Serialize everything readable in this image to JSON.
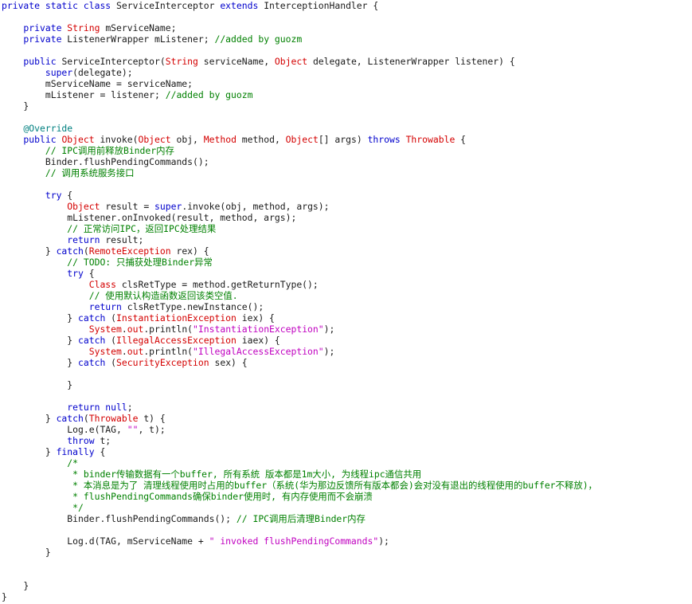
{
  "colors": {
    "background": "#ffffff",
    "text": "#1a1a1a",
    "keyword": "#0000cc",
    "type": "#d40000",
    "string": "#c000c0",
    "comment": "#008000",
    "annotation": "#008080"
  },
  "code": {
    "language": "java",
    "lines": [
      [
        [
          "kw",
          "private static class "
        ],
        [
          "plain",
          "ServiceInterceptor "
        ],
        [
          "kw",
          "extends "
        ],
        [
          "plain",
          "InterceptionHandler {"
        ]
      ],
      [],
      [
        [
          "kw",
          "    private "
        ],
        [
          "typ",
          "String "
        ],
        [
          "plain",
          "mServiceName;"
        ]
      ],
      [
        [
          "kw",
          "    private "
        ],
        [
          "plain",
          "ListenerWrapper mListener; "
        ],
        [
          "cmt",
          "//added by guozm"
        ]
      ],
      [],
      [
        [
          "kw",
          "    public "
        ],
        [
          "plain",
          "ServiceInterceptor("
        ],
        [
          "typ",
          "String "
        ],
        [
          "plain",
          "serviceName, "
        ],
        [
          "typ",
          "Object "
        ],
        [
          "plain",
          "delegate, ListenerWrapper listener) {"
        ]
      ],
      [
        [
          "kw",
          "        super"
        ],
        [
          "plain",
          "(delegate);"
        ]
      ],
      [
        [
          "plain",
          "        mServiceName = serviceName;"
        ]
      ],
      [
        [
          "plain",
          "        mListener = listener; "
        ],
        [
          "cmt",
          "//added by guozm"
        ]
      ],
      [
        [
          "plain",
          "    }"
        ]
      ],
      [],
      [
        [
          "ann",
          "    @Override"
        ]
      ],
      [
        [
          "kw",
          "    public "
        ],
        [
          "typ",
          "Object "
        ],
        [
          "plain",
          "invoke("
        ],
        [
          "typ",
          "Object "
        ],
        [
          "plain",
          "obj, "
        ],
        [
          "typ",
          "Method "
        ],
        [
          "plain",
          "method, "
        ],
        [
          "typ",
          "Object"
        ],
        [
          "plain",
          "[] args) "
        ],
        [
          "kw",
          "throws "
        ],
        [
          "typ",
          "Throwable "
        ],
        [
          "plain",
          "{"
        ]
      ],
      [
        [
          "cmt",
          "        // IPC调用前释放Binder内存"
        ]
      ],
      [
        [
          "plain",
          "        Binder.flushPendingCommands();"
        ]
      ],
      [
        [
          "cmt",
          "        // 调用系统服务接口"
        ]
      ],
      [],
      [
        [
          "kw",
          "        try "
        ],
        [
          "plain",
          "{"
        ]
      ],
      [
        [
          "typ",
          "            Object "
        ],
        [
          "plain",
          "result = "
        ],
        [
          "kw",
          "super"
        ],
        [
          "plain",
          ".invoke(obj, method, args);"
        ]
      ],
      [
        [
          "plain",
          "            mListener.onInvoked(result, method, args);"
        ]
      ],
      [
        [
          "cmt",
          "            // 正常访问IPC，返回IPC处理结果"
        ]
      ],
      [
        [
          "kw",
          "            return "
        ],
        [
          "plain",
          "result;"
        ]
      ],
      [
        [
          "plain",
          "        } "
        ],
        [
          "kw",
          "catch"
        ],
        [
          "plain",
          "("
        ],
        [
          "typ",
          "RemoteException "
        ],
        [
          "plain",
          "rex) {"
        ]
      ],
      [
        [
          "cmt",
          "            // TODO: 只捕获处理Binder异常"
        ]
      ],
      [
        [
          "kw",
          "            try "
        ],
        [
          "plain",
          "{"
        ]
      ],
      [
        [
          "typ",
          "                Class "
        ],
        [
          "plain",
          "clsRetType = method.getReturnType();"
        ]
      ],
      [
        [
          "cmt",
          "                // 使用默认构造函数返回该类空值."
        ]
      ],
      [
        [
          "kw",
          "                return "
        ],
        [
          "plain",
          "clsRetType.newInstance();"
        ]
      ],
      [
        [
          "plain",
          "            } "
        ],
        [
          "kw",
          "catch "
        ],
        [
          "plain",
          "("
        ],
        [
          "typ",
          "InstantiationException "
        ],
        [
          "plain",
          "iex) {"
        ]
      ],
      [
        [
          "typ",
          "                System"
        ],
        [
          "plain",
          "."
        ],
        [
          "typ",
          "out"
        ],
        [
          "plain",
          ".println("
        ],
        [
          "str",
          "\"InstantiationException\""
        ],
        [
          "plain",
          ");"
        ]
      ],
      [
        [
          "plain",
          "            } "
        ],
        [
          "kw",
          "catch "
        ],
        [
          "plain",
          "("
        ],
        [
          "typ",
          "IllegalAccessException "
        ],
        [
          "plain",
          "iaex) {"
        ]
      ],
      [
        [
          "typ",
          "                System"
        ],
        [
          "plain",
          "."
        ],
        [
          "typ",
          "out"
        ],
        [
          "plain",
          ".println("
        ],
        [
          "str",
          "\"IllegalAccessException\""
        ],
        [
          "plain",
          ");"
        ]
      ],
      [
        [
          "plain",
          "            } "
        ],
        [
          "kw",
          "catch "
        ],
        [
          "plain",
          "("
        ],
        [
          "typ",
          "SecurityException "
        ],
        [
          "plain",
          "sex) {"
        ]
      ],
      [],
      [
        [
          "plain",
          "            }"
        ]
      ],
      [],
      [
        [
          "kw",
          "            return null"
        ],
        [
          "plain",
          ";"
        ]
      ],
      [
        [
          "plain",
          "        } "
        ],
        [
          "kw",
          "catch"
        ],
        [
          "plain",
          "("
        ],
        [
          "typ",
          "Throwable "
        ],
        [
          "plain",
          "t) {"
        ]
      ],
      [
        [
          "plain",
          "            Log.e(TAG, "
        ],
        [
          "str",
          "\"\""
        ],
        [
          "plain",
          ", t);"
        ]
      ],
      [
        [
          "kw",
          "            throw "
        ],
        [
          "plain",
          "t;"
        ]
      ],
      [
        [
          "plain",
          "        } "
        ],
        [
          "kw",
          "finally "
        ],
        [
          "plain",
          "{"
        ]
      ],
      [
        [
          "cmt",
          "            /*"
        ]
      ],
      [
        [
          "cmt",
          "             * binder传输数据有一个buffer, 所有系统 版本都是1m大小, 为线程ipc通信共用"
        ]
      ],
      [
        [
          "cmt",
          "             * 本消息是为了 清理线程使用时占用的buffer（系统(华为那边反馈所有版本都会)会对没有退出的线程使用的buffer不释放)，"
        ]
      ],
      [
        [
          "cmt",
          "             * flushPendingCommands确保binder使用时, 有内存使用而不会崩溃"
        ]
      ],
      [
        [
          "cmt",
          "             */"
        ]
      ],
      [
        [
          "plain",
          "            Binder.flushPendingCommands(); "
        ],
        [
          "cmt",
          "// IPC调用后清理Binder内存"
        ]
      ],
      [],
      [
        [
          "plain",
          "            Log.d(TAG, mServiceName + "
        ],
        [
          "str",
          "\" invoked flushPendingCommands\""
        ],
        [
          "plain",
          ");"
        ]
      ],
      [
        [
          "plain",
          "        }"
        ]
      ],
      [],
      [],
      [
        [
          "plain",
          "    }"
        ]
      ],
      [
        [
          "plain",
          "}"
        ]
      ]
    ]
  }
}
